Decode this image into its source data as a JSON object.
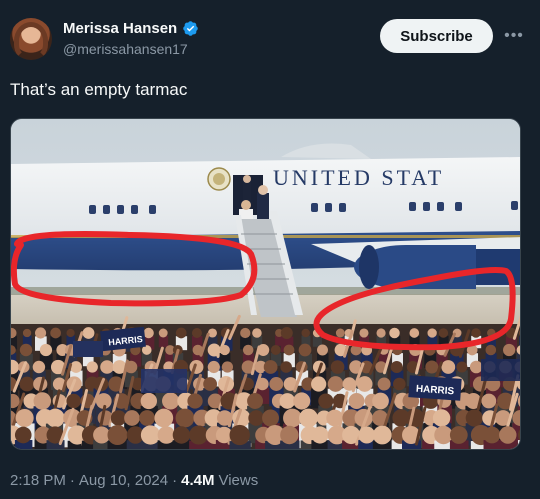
{
  "author": {
    "name": "Merissa Hansen",
    "handle": "@merissahansen17",
    "verified": true
  },
  "actions": {
    "subscribe_label": "Subscribe",
    "more_icon": "more-horizontal-icon"
  },
  "post": {
    "text": "That’s an empty tarmac"
  },
  "image": {
    "aircraft_lettering": "UNITED STAT",
    "sign_texts": [
      "HARRIS",
      "HARRIS"
    ]
  },
  "meta": {
    "time": "2:18 PM",
    "separator1": "·",
    "date": "Aug 10, 2024",
    "separator2": "·",
    "views_count": "4.4M",
    "views_label": "Views"
  },
  "colors": {
    "background": "#15202b",
    "verified": "#1d9bf0",
    "annotation": "#e8262a"
  }
}
